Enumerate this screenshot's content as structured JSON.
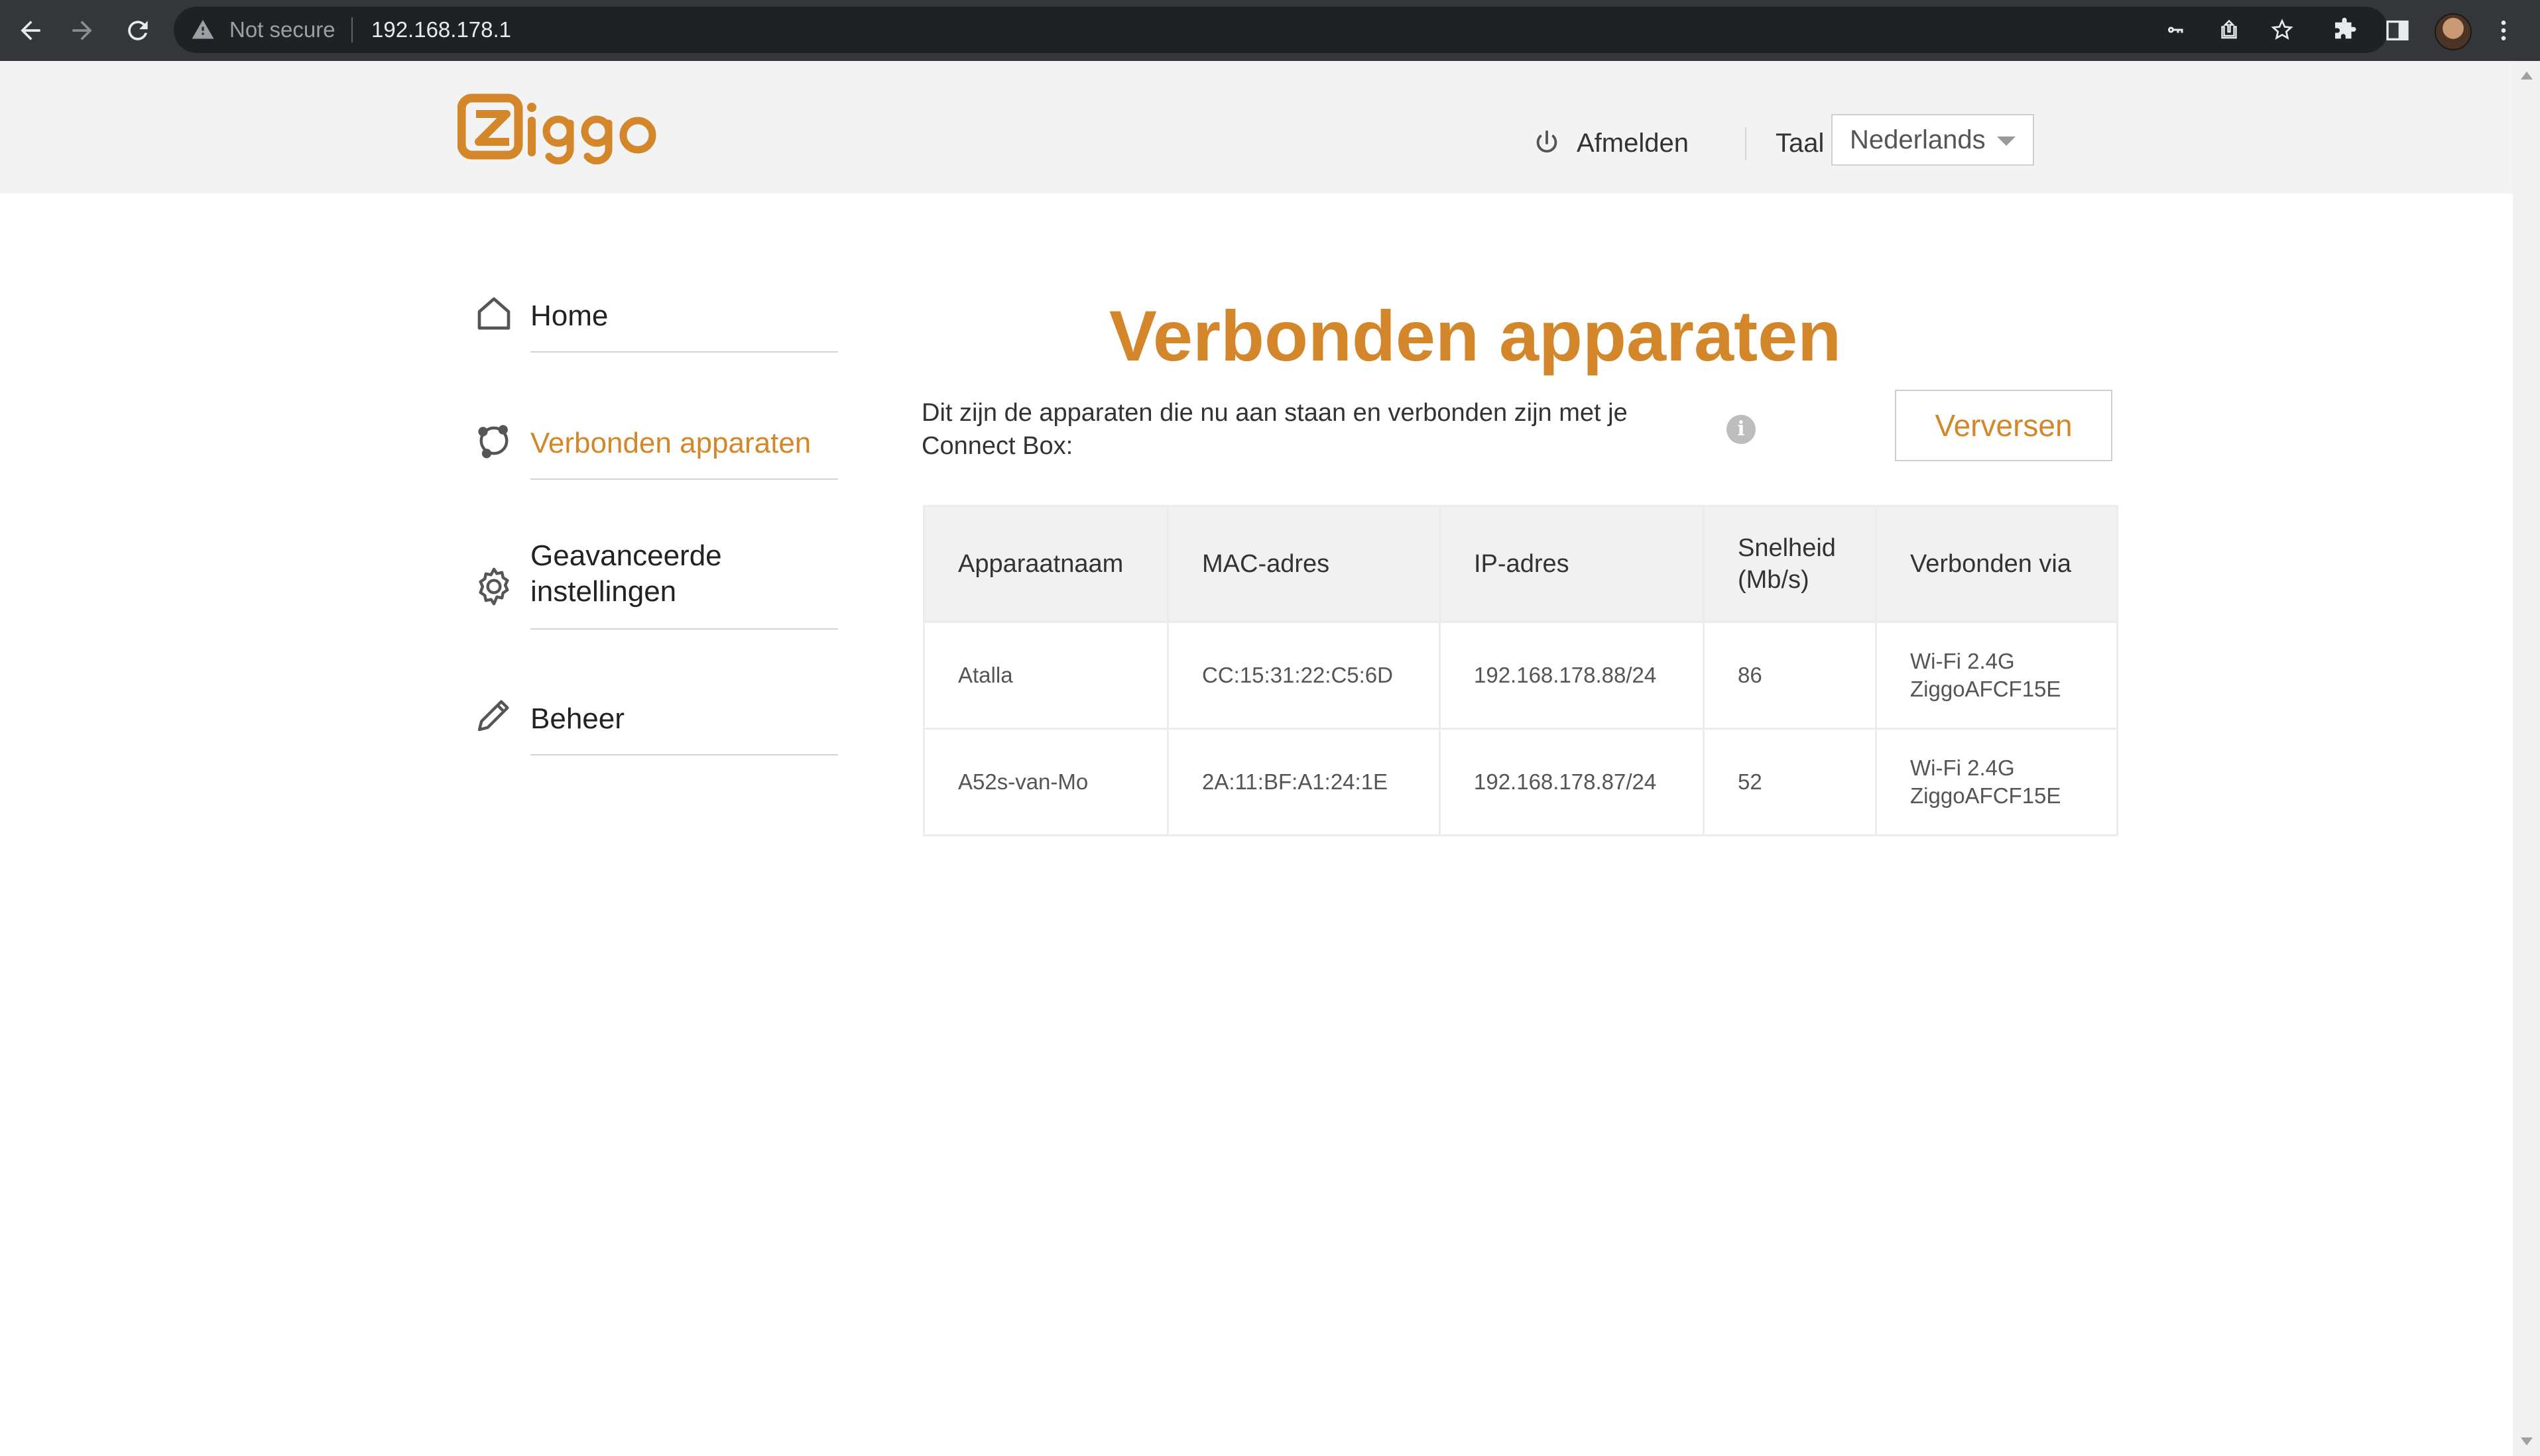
{
  "browser": {
    "security_text": "Not secure",
    "url": "192.168.178.1"
  },
  "header": {
    "logo_text": "ziggo",
    "logout_label": "Afmelden",
    "language_label": "Taal",
    "language_selected": "Nederlands"
  },
  "sidebar": {
    "items": [
      {
        "label": "Home",
        "icon": "home-icon",
        "active": false
      },
      {
        "label": "Verbonden apparaten",
        "icon": "network-icon",
        "active": true
      },
      {
        "label": "Geavanceerde instellingen",
        "icon": "gear-icon",
        "active": false
      },
      {
        "label": "Beheer",
        "icon": "pencil-icon",
        "active": false
      }
    ]
  },
  "main": {
    "title": "Verbonden apparaten",
    "intro": "Dit zijn de apparaten die nu aan staan en verbonden zijn met je Connect Box:",
    "refresh_label": "Verversen",
    "table": {
      "headers": [
        "Apparaatnaam",
        "MAC-adres",
        "IP-adres",
        "Snelheid (Mb/s)",
        "Verbonden via"
      ],
      "rows": [
        {
          "name": "Atalla",
          "mac": "CC:15:31:22:C5:6D",
          "ip": "192.168.178.88/24",
          "speed": "86",
          "via_band": "Wi-Fi 2.4G",
          "via_ssid": "ZiggoAFCF15E"
        },
        {
          "name": "A52s-van-Mo",
          "mac": "2A:11:BF:A1:24:1E",
          "ip": "192.168.178.87/24",
          "speed": "52",
          "via_band": "Wi-Fi 2.4G",
          "via_ssid": "ZiggoAFCF15E"
        }
      ]
    }
  },
  "colors": {
    "accent": "#d3872a",
    "header_bg": "#f3f3f3",
    "chrome_bg": "#35363a"
  }
}
